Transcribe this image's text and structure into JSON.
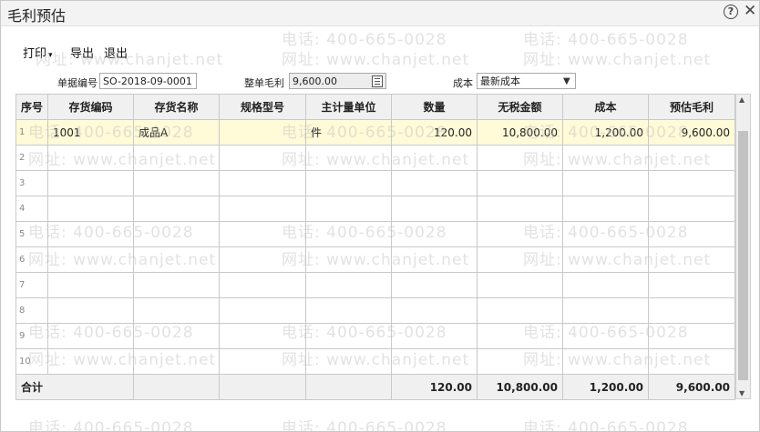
{
  "window": {
    "title": "毛利预估"
  },
  "menu": {
    "print": "打印",
    "export": "导出",
    "exit": "退出"
  },
  "form": {
    "doc_no_label": "单据编号",
    "doc_no_value": "SO-2018-09-0001",
    "total_profit_label": "整单毛利",
    "total_profit_value": "9,600.00",
    "cost_label": "成本",
    "cost_value": "最新成本"
  },
  "table": {
    "headers": [
      "序号",
      "存货编码",
      "存货名称",
      "规格型号",
      "主计量单位",
      "数量",
      "无税金额",
      "成本",
      "预估毛利"
    ],
    "rows": [
      {
        "seq": "1",
        "code": "1001",
        "name": "成品A",
        "spec": "",
        "unit": "件",
        "qty": "120.00",
        "amount": "10,800.00",
        "cost": "1,200.00",
        "profit": "9,600.00"
      },
      {
        "seq": "2",
        "code": "",
        "name": "",
        "spec": "",
        "unit": "",
        "qty": "",
        "amount": "",
        "cost": "",
        "profit": ""
      },
      {
        "seq": "3",
        "code": "",
        "name": "",
        "spec": "",
        "unit": "",
        "qty": "",
        "amount": "",
        "cost": "",
        "profit": ""
      },
      {
        "seq": "4",
        "code": "",
        "name": "",
        "spec": "",
        "unit": "",
        "qty": "",
        "amount": "",
        "cost": "",
        "profit": ""
      },
      {
        "seq": "5",
        "code": "",
        "name": "",
        "spec": "",
        "unit": "",
        "qty": "",
        "amount": "",
        "cost": "",
        "profit": ""
      },
      {
        "seq": "6",
        "code": "",
        "name": "",
        "spec": "",
        "unit": "",
        "qty": "",
        "amount": "",
        "cost": "",
        "profit": ""
      },
      {
        "seq": "7",
        "code": "",
        "name": "",
        "spec": "",
        "unit": "",
        "qty": "",
        "amount": "",
        "cost": "",
        "profit": ""
      },
      {
        "seq": "8",
        "code": "",
        "name": "",
        "spec": "",
        "unit": "",
        "qty": "",
        "amount": "",
        "cost": "",
        "profit": ""
      },
      {
        "seq": "9",
        "code": "",
        "name": "",
        "spec": "",
        "unit": "",
        "qty": "",
        "amount": "",
        "cost": "",
        "profit": ""
      },
      {
        "seq": "10",
        "code": "",
        "name": "",
        "spec": "",
        "unit": "",
        "qty": "",
        "amount": "",
        "cost": "",
        "profit": ""
      }
    ],
    "total": {
      "label": "合计",
      "qty": "120.00",
      "amount": "10,800.00",
      "cost": "1,200.00",
      "profit": "9,600.00"
    }
  },
  "watermark": {
    "phone": "电话: 400-665-0028",
    "site": "网址: www.chanjet.net"
  },
  "icons": {
    "help": "help-icon",
    "close": "close-icon",
    "calculator": "calculator-icon",
    "dropdown": "chevron-down-icon"
  }
}
